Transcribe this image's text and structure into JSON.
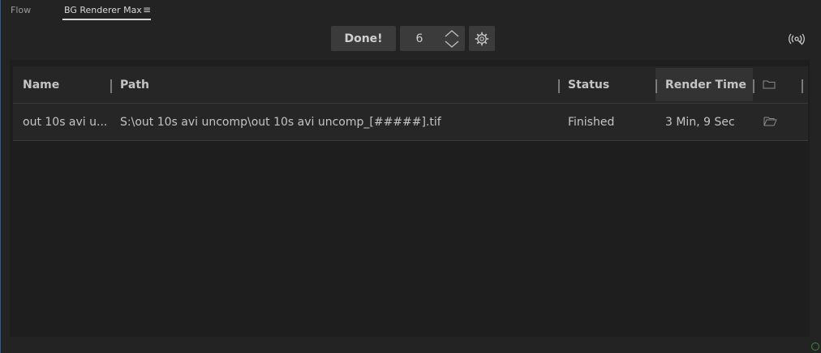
{
  "tabs": [
    {
      "label": "Flow"
    },
    {
      "label": "BG Renderer Max"
    }
  ],
  "toolbar": {
    "done_label": "Done!",
    "stepper_value": "6"
  },
  "table": {
    "columns": [
      "Name",
      "Path",
      "Status",
      "Render Time"
    ],
    "rows": [
      {
        "name": "out 10s avi u...",
        "path": "S:\\out 10s avi uncomp\\out 10s avi uncomp_[#####].tif",
        "status": "Finished",
        "render_time": "3 Min, 9 Sec"
      }
    ]
  },
  "icons": {
    "tab_menu": "hamburger-icon",
    "stepper_up": "chevron-up-icon",
    "stepper_down": "chevron-down-icon",
    "settings": "gear-icon",
    "broadcast": "broadcast-icon",
    "header_folder": "folder-icon",
    "row_folder": "folder-open-icon"
  }
}
